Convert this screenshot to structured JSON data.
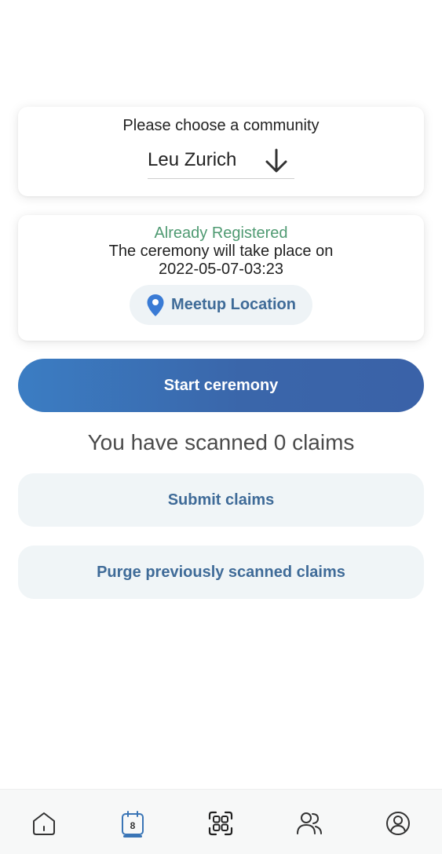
{
  "community": {
    "prompt": "Please choose a community",
    "selected": "Leu Zurich"
  },
  "meetup": {
    "status": "Already Registered",
    "ceremony_line": "The ceremony will take place on",
    "ceremony_datetime": "2022-05-07-03:23",
    "location_label": "Meetup Location"
  },
  "actions": {
    "start_label": "Start ceremony",
    "scan_status": "You have scanned 0 claims",
    "submit_label": "Submit claims",
    "purge_label": "Purge previously scanned claims"
  },
  "nav": {
    "active": "ceremonies",
    "items": [
      {
        "name": "home",
        "icon": "home-icon"
      },
      {
        "name": "ceremonies",
        "icon": "calendar-icon",
        "badge": "8"
      },
      {
        "name": "scan",
        "icon": "qr-scan-icon"
      },
      {
        "name": "contacts",
        "icon": "people-icon"
      },
      {
        "name": "profile",
        "icon": "profile-icon"
      }
    ]
  },
  "colors": {
    "accent": "#3a75b6",
    "registered_green": "#4f9a72",
    "button_text": "#3f6b98",
    "soft_button_bg": "#f0f5f7"
  }
}
